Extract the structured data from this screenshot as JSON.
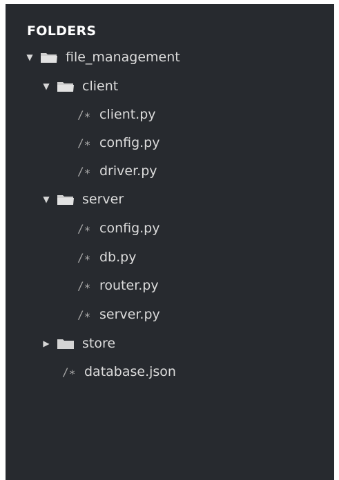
{
  "sidebar": {
    "title": "FOLDERS",
    "items": [
      {
        "kind": "folder",
        "label": "file_management",
        "expanded": true,
        "arrow": "▼"
      },
      {
        "kind": "folder",
        "label": "client",
        "expanded": true,
        "arrow": "▼"
      },
      {
        "kind": "file",
        "label": "client.py",
        "icon": "/∗"
      },
      {
        "kind": "file",
        "label": "config.py",
        "icon": "/∗"
      },
      {
        "kind": "file",
        "label": "driver.py",
        "icon": "/∗"
      },
      {
        "kind": "folder",
        "label": "server",
        "expanded": true,
        "arrow": "▼"
      },
      {
        "kind": "file",
        "label": "config.py",
        "icon": "/∗"
      },
      {
        "kind": "file",
        "label": "db.py",
        "icon": "/∗"
      },
      {
        "kind": "file",
        "label": "router.py",
        "icon": "/∗"
      },
      {
        "kind": "file",
        "label": "server.py",
        "icon": "/∗"
      },
      {
        "kind": "folder",
        "label": "store",
        "expanded": false,
        "arrow": "▶"
      },
      {
        "kind": "file",
        "label": "database.json",
        "icon": "/∗"
      }
    ]
  },
  "colors": {
    "background": "#272a2f",
    "text": "#dcdcdc",
    "header": "#ffffff",
    "folder": "#d4d4d4"
  }
}
